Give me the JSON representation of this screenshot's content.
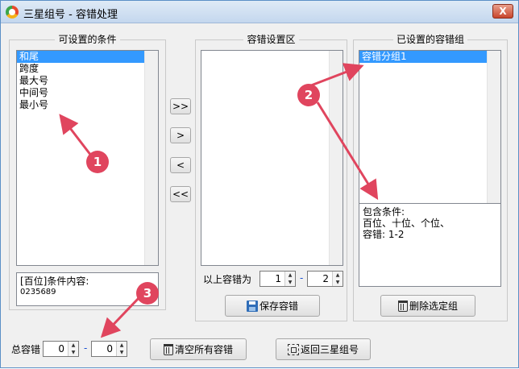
{
  "window": {
    "title": "三星组号 - 容错处理",
    "close_label": "X"
  },
  "left_group": {
    "title": "可设置的条件",
    "items": [
      "和尾",
      "跨度",
      "最大号",
      "中间号",
      "最小号"
    ],
    "detail_line1": "[百位]条件内容:",
    "detail_line2": "0235689"
  },
  "move_buttons": {
    "add_all": ">>",
    "add": ">",
    "remove": "<",
    "remove_all": "<<"
  },
  "middle_group": {
    "title": "容错设置区",
    "tolerance_label": "以上容错为",
    "spin_min": "1",
    "spin_max": "2",
    "save_label": "保存容错"
  },
  "right_group": {
    "title": "已设置的容错组",
    "items": [
      "容错分组1"
    ],
    "detail_line1": "包含条件:",
    "detail_line2": "百位、十位、个位、",
    "detail_line3": "容错: 1-2",
    "delete_label": "删除选定组"
  },
  "bottom": {
    "total_label": "总容错",
    "spin_min": "0",
    "spin_max": "0",
    "clear_label": "清空所有容错",
    "back_label": "返回三星组号"
  },
  "callouts": [
    "1",
    "2",
    "3"
  ],
  "colors": {
    "accent": "#3399ff",
    "callout": "#e0455e",
    "dash": "#1a4fd1"
  }
}
